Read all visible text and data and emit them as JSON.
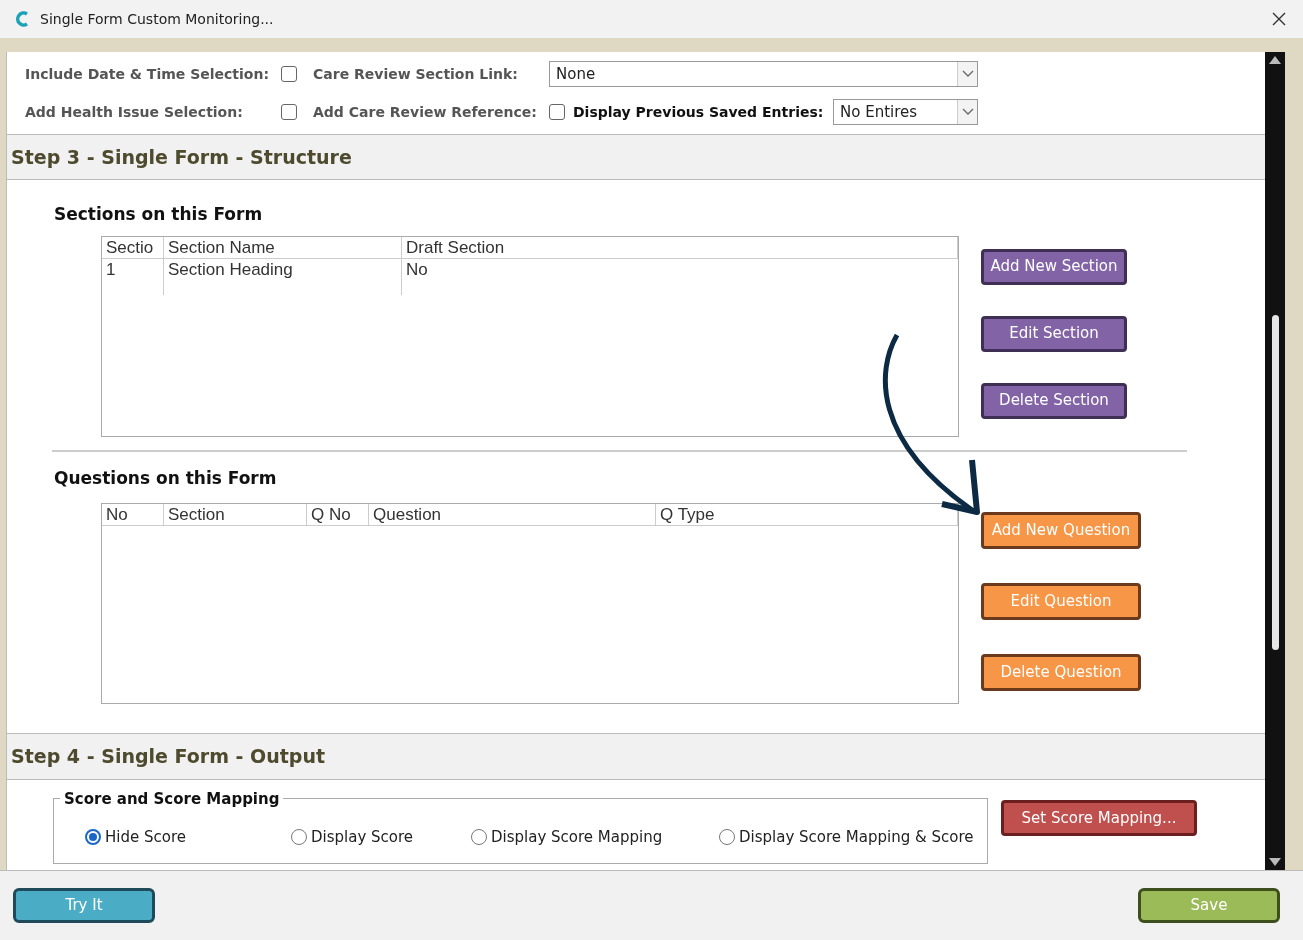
{
  "window": {
    "title": "Single Form Custom Monitoring..."
  },
  "options": {
    "row1": [
      {
        "kind": "checkbox",
        "label": "Include Date & Time Selection:",
        "checked": false
      },
      {
        "kind": "dropdown",
        "label": "Care Review Section Link:",
        "value": "None"
      }
    ],
    "row2": [
      {
        "kind": "checkbox",
        "label": "Add Health Issue Selection:",
        "checked": false
      },
      {
        "kind": "checkbox",
        "label": "Add Care Review Reference:",
        "checked": false
      },
      {
        "kind": "dropdown",
        "label": "Display Previous Saved Entries:",
        "value": "No Entires"
      }
    ]
  },
  "step3": {
    "title": "Step 3 - Single Form - Structure",
    "sections": {
      "heading": "Sections on this Form",
      "columns": [
        "Sectio",
        "Section Name",
        "Draft Section"
      ],
      "rows": [
        [
          "1",
          "Section Heading",
          "No"
        ]
      ],
      "buttons": [
        "Add New Section",
        "Edit Section",
        "Delete Section"
      ]
    },
    "questions": {
      "heading": "Questions on this Form",
      "columns": [
        "No",
        "Section",
        "Q No",
        "Question",
        "Q Type"
      ],
      "buttons": [
        "Add New Question",
        "Edit Question",
        "Delete Question"
      ]
    }
  },
  "step4": {
    "title": "Step 4 - Single Form - Output",
    "group": "Score and Score Mapping",
    "radios": [
      {
        "label": "Hide Score",
        "selected": true
      },
      {
        "label": "Display Score",
        "selected": false
      },
      {
        "label": "Display Score Mapping",
        "selected": false
      },
      {
        "label": "Display Score Mapping & Score",
        "selected": false
      }
    ],
    "button": "Set Score Mapping..."
  },
  "footer": {
    "left": "Try It",
    "right": "Save"
  }
}
